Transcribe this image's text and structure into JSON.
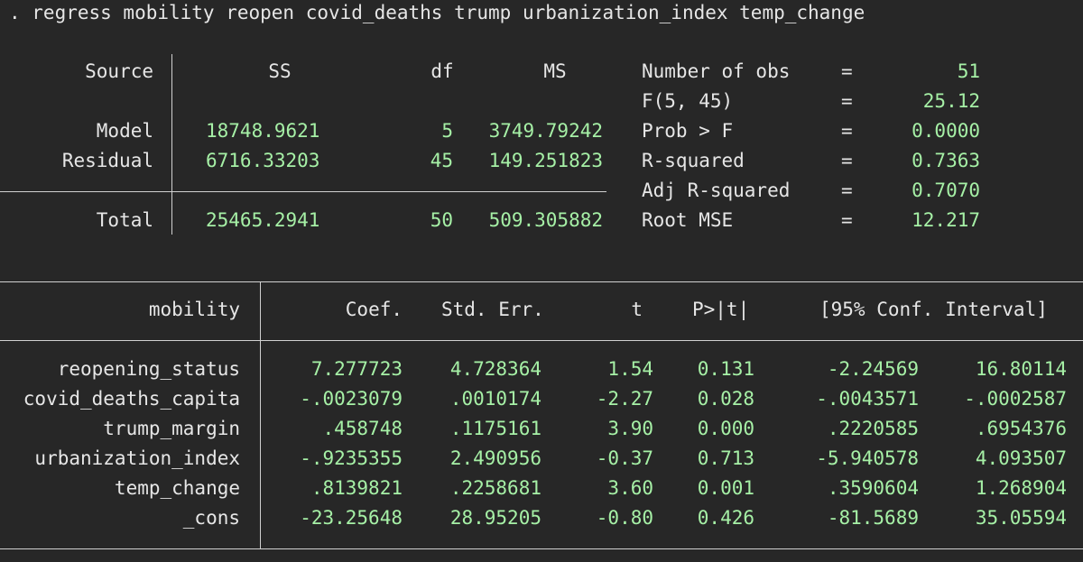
{
  "command": ". regress mobility reopen covid_deaths trump urbanization_index temp_change",
  "colors": {
    "background": "#272727",
    "text": "#e6e6e6",
    "numbers": "#a6f0a6",
    "rules": "#d0d0d0"
  },
  "anova": {
    "headers": {
      "source": "Source",
      "ss": "SS",
      "df": "df",
      "ms": "MS"
    },
    "rows": [
      {
        "source": "Model",
        "ss": "18748.9621",
        "df": "5",
        "ms": "3749.79242"
      },
      {
        "source": "Residual",
        "ss": "6716.33203",
        "df": "45",
        "ms": "149.251823"
      }
    ],
    "total": {
      "source": "Total",
      "ss": "25465.2941",
      "df": "50",
      "ms": "509.305882"
    }
  },
  "stats": [
    {
      "label": "Number of obs",
      "eq": "=",
      "value": "51"
    },
    {
      "label": "F(5, 45)",
      "eq": "=",
      "value": "25.12"
    },
    {
      "label": "Prob > F",
      "eq": "=",
      "value": "0.0000"
    },
    {
      "label": "R-squared",
      "eq": "=",
      "value": "0.7363"
    },
    {
      "label": "Adj R-squared",
      "eq": "=",
      "value": "0.7070"
    },
    {
      "label": "Root MSE",
      "eq": "=",
      "value": "12.217"
    }
  ],
  "coef_table": {
    "headers": {
      "depvar": "mobility",
      "coef": "Coef.",
      "se": "Std. Err.",
      "t": "t",
      "p": "P>|t|",
      "ci": "[95% Conf. Interval]"
    },
    "rows": [
      {
        "name": "reopening_status",
        "coef": "7.277723",
        "se": "4.728364",
        "t": "1.54",
        "p": "0.131",
        "lo": "-2.24569",
        "hi": "16.80114"
      },
      {
        "name": "covid_deaths_capita",
        "coef": "-.0023079",
        "se": ".0010174",
        "t": "-2.27",
        "p": "0.028",
        "lo": "-.0043571",
        "hi": "-.0002587"
      },
      {
        "name": "trump_margin",
        "coef": ".458748",
        "se": ".1175161",
        "t": "3.90",
        "p": "0.000",
        "lo": ".2220585",
        "hi": ".6954376"
      },
      {
        "name": "urbanization_index",
        "coef": "-.9235355",
        "se": "2.490956",
        "t": "-0.37",
        "p": "0.713",
        "lo": "-5.940578",
        "hi": "4.093507"
      },
      {
        "name": "temp_change",
        "coef": ".8139821",
        "se": ".2258681",
        "t": "3.60",
        "p": "0.001",
        "lo": ".3590604",
        "hi": "1.268904"
      },
      {
        "name": "_cons",
        "coef": "-23.25648",
        "se": "28.95205",
        "t": "-0.80",
        "p": "0.426",
        "lo": "-81.5689",
        "hi": "35.05594"
      }
    ]
  }
}
